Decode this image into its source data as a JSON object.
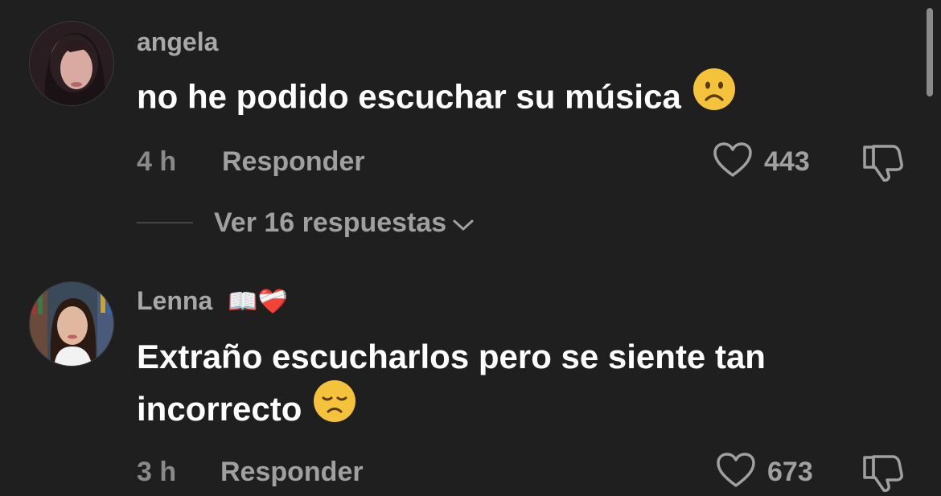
{
  "comments": [
    {
      "username": "angela",
      "username_emoji": "",
      "text": "no he podido escuchar su música",
      "emoji": "sad-face",
      "time": "4 h",
      "reply_label": "Responder",
      "likes": "443",
      "view_replies": "Ver 16 respuestas"
    },
    {
      "username": "Lenna",
      "username_emoji": "📖❤️‍🩹",
      "text": "Extraño escucharlos pero se siente tan incorrecto",
      "emoji": "disappointed-face",
      "time": "3 h",
      "reply_label": "Responder",
      "likes": "673"
    }
  ],
  "icons": {
    "like": "heart-outline-icon",
    "dislike": "thumbs-down-outline-icon",
    "expand": "chevron-down-icon"
  },
  "colors": {
    "background": "#1f1f1f",
    "text": "#ffffff",
    "muted": "#a0a0a0",
    "emoji": "#f5c33b"
  }
}
